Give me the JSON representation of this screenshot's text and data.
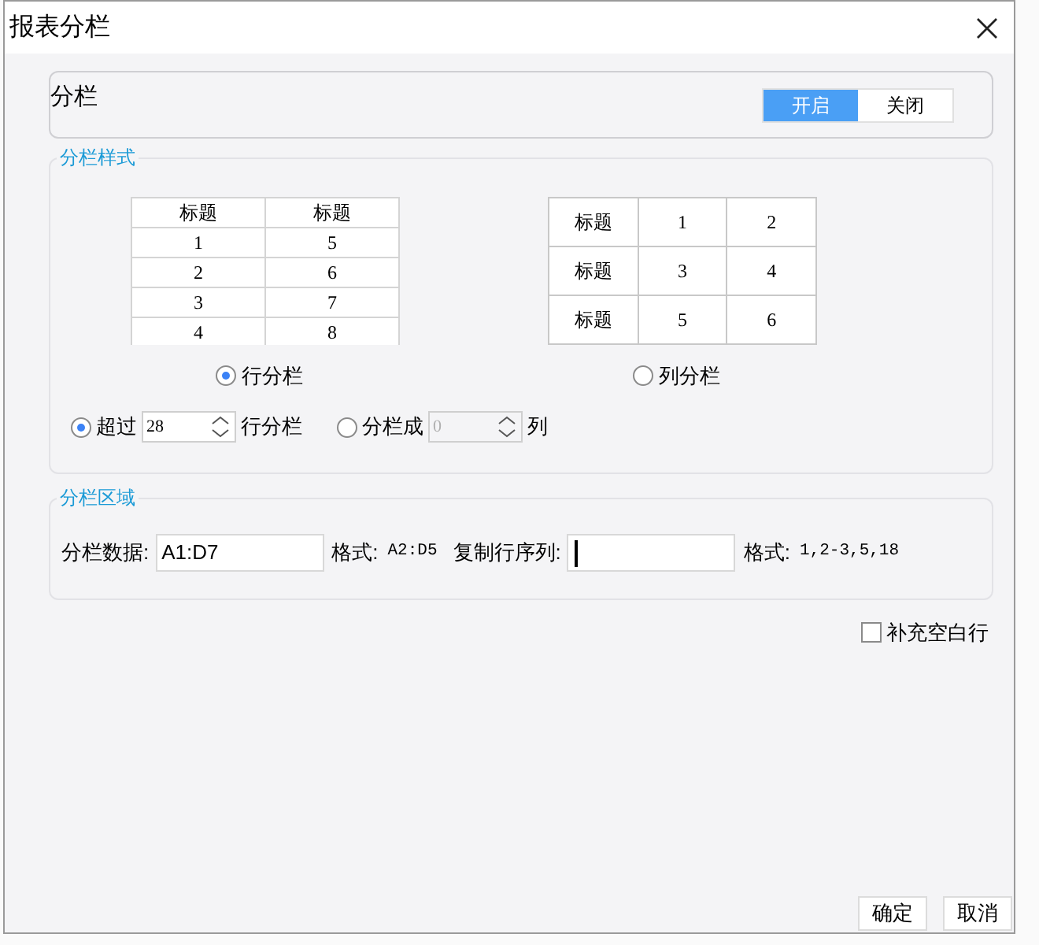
{
  "window": {
    "title": "报表分栏"
  },
  "split": {
    "label": "分栏",
    "options": [
      {
        "label": "开启",
        "selected": true
      },
      {
        "label": "关闭",
        "selected": false
      }
    ]
  },
  "style_section": {
    "title": "分栏样式",
    "modes": [
      {
        "kind": "row",
        "label": "行分栏",
        "selected": true,
        "header": [
          "标题",
          "标题"
        ],
        "rows": [
          [
            "1",
            "5"
          ],
          [
            "2",
            "6"
          ],
          [
            "3",
            "7"
          ],
          [
            "4",
            "8"
          ]
        ]
      },
      {
        "kind": "column",
        "label": "列分栏",
        "selected": false,
        "rows": [
          [
            "标题",
            "1",
            "2"
          ],
          [
            "标题",
            "3",
            "4"
          ],
          [
            "标题",
            "5",
            "6"
          ]
        ]
      }
    ],
    "options": [
      {
        "prefix": "超过",
        "value": "28",
        "suffix": "行分栏",
        "selected": true,
        "disabled": false
      },
      {
        "prefix": "分栏成",
        "value": "0",
        "suffix": "列",
        "selected": false,
        "disabled": true
      }
    ]
  },
  "area_section": {
    "title": "分栏区域",
    "fields": [
      {
        "label": "分栏数据:",
        "value": "A1:D7",
        "focused": false,
        "format_label": "格式:",
        "format": "A2:D5"
      },
      {
        "label": "复制行序列:",
        "focused": true,
        "format_label": "格式:",
        "format": "1,2-3,5,18"
      }
    ]
  },
  "fill_blank_rows": {
    "label": "补充空白行",
    "checked": false
  },
  "buttons": [
    "确定",
    "取消"
  ]
}
